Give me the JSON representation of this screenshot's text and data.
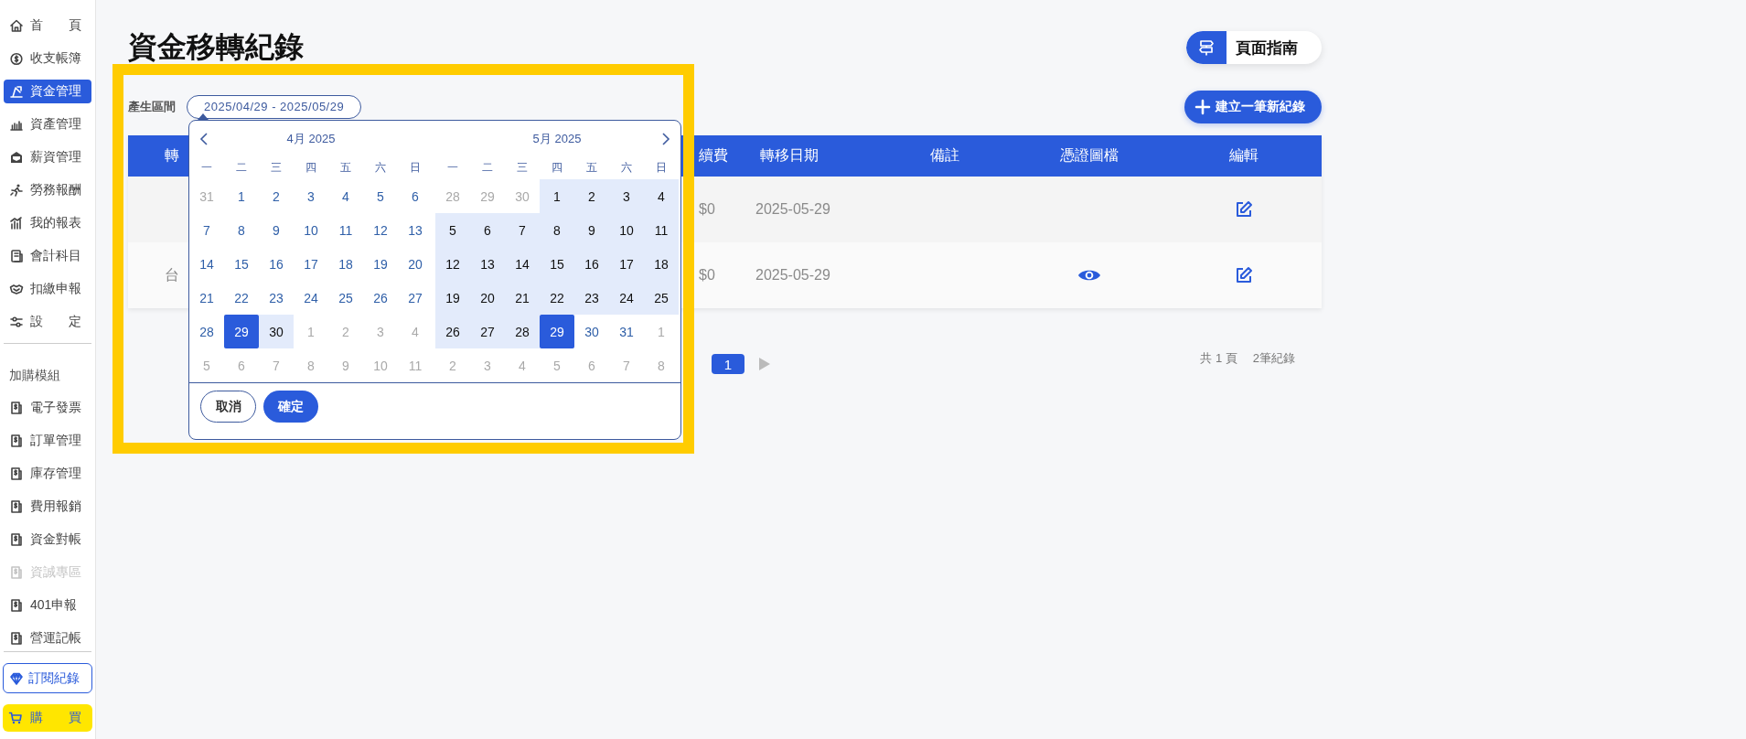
{
  "sidebar": {
    "items": [
      {
        "label": "首頁",
        "selected": false,
        "disabled": false
      },
      {
        "label": "收支帳簿",
        "selected": false,
        "disabled": false
      },
      {
        "label": "資金管理",
        "selected": true,
        "disabled": false
      },
      {
        "label": "資產管理",
        "selected": false,
        "disabled": false
      },
      {
        "label": "薪資管理",
        "selected": false,
        "disabled": false
      },
      {
        "label": "勞務報酬",
        "selected": false,
        "disabled": false
      },
      {
        "label": "我的報表",
        "selected": false,
        "disabled": false
      },
      {
        "label": "會計科目",
        "selected": false,
        "disabled": false
      },
      {
        "label": "扣繳申報",
        "selected": false,
        "disabled": false
      },
      {
        "label": "設定",
        "selected": false,
        "disabled": false
      }
    ],
    "section_title": "加購模組",
    "addon_items": [
      {
        "label": "電子發票",
        "selected": false,
        "disabled": false
      },
      {
        "label": "訂單管理",
        "selected": false,
        "disabled": false
      },
      {
        "label": "庫存管理",
        "selected": false,
        "disabled": false
      },
      {
        "label": "費用報銷",
        "selected": false,
        "disabled": false
      },
      {
        "label": "資金對帳",
        "selected": false,
        "disabled": false
      },
      {
        "label": "資誠專區",
        "selected": false,
        "disabled": true
      },
      {
        "label": "401申報",
        "selected": false,
        "disabled": false
      },
      {
        "label": "營運記帳",
        "selected": false,
        "disabled": false
      }
    ],
    "subscription_button": "訂閱紀錄",
    "buy_button": "購買"
  },
  "page": {
    "title": "資金移轉紀錄",
    "guide_button": "頁面指南",
    "new_record_button": "建立一筆新紀錄"
  },
  "date_filter": {
    "label": "產生區間",
    "value": "2025/04/29 - 2025/05/29"
  },
  "table": {
    "columns": [
      "轉",
      "續費",
      "轉移日期",
      "備註",
      "憑證圖檔",
      "編輯"
    ],
    "rows": [
      {
        "column_1": null,
        "fee": "$0",
        "date": "2025-05-29",
        "has_attachment": false
      },
      {
        "column_1": "台",
        "fee": "$0",
        "date": "2025-05-29",
        "has_attachment": true
      }
    ]
  },
  "pagination": {
    "pages": [
      {
        "label": "1",
        "selected": true
      }
    ],
    "total_pages": "共 1 頁",
    "total_records": "2筆紀錄"
  },
  "calendar": {
    "months": [
      {
        "title": "4月 2025",
        "weekdays": [
          "一",
          "二",
          "三",
          "四",
          "五",
          "六",
          "日"
        ],
        "weeks": [
          [
            {
              "label": "31",
              "kind": "outside",
              "selected": false
            },
            {
              "label": "1",
              "kind": "normal",
              "selected": false
            },
            {
              "label": "2",
              "kind": "normal",
              "selected": false
            },
            {
              "label": "3",
              "kind": "normal",
              "selected": false
            },
            {
              "label": "4",
              "kind": "normal",
              "selected": false
            },
            {
              "label": "5",
              "kind": "normal",
              "selected": false
            },
            {
              "label": "6",
              "kind": "normal",
              "selected": false
            }
          ],
          [
            {
              "label": "7",
              "kind": "normal",
              "selected": false
            },
            {
              "label": "8",
              "kind": "normal",
              "selected": false
            },
            {
              "label": "9",
              "kind": "normal",
              "selected": false
            },
            {
              "label": "10",
              "kind": "normal",
              "selected": false
            },
            {
              "label": "11",
              "kind": "normal",
              "selected": false
            },
            {
              "label": "12",
              "kind": "normal",
              "selected": false
            },
            {
              "label": "13",
              "kind": "normal",
              "selected": false
            }
          ],
          [
            {
              "label": "14",
              "kind": "normal",
              "selected": false
            },
            {
              "label": "15",
              "kind": "normal",
              "selected": false
            },
            {
              "label": "16",
              "kind": "normal",
              "selected": false
            },
            {
              "label": "17",
              "kind": "normal",
              "selected": false
            },
            {
              "label": "18",
              "kind": "normal",
              "selected": false
            },
            {
              "label": "19",
              "kind": "normal",
              "selected": false
            },
            {
              "label": "20",
              "kind": "normal",
              "selected": false
            }
          ],
          [
            {
              "label": "21",
              "kind": "normal",
              "selected": false
            },
            {
              "label": "22",
              "kind": "normal",
              "selected": false
            },
            {
              "label": "23",
              "kind": "normal",
              "selected": false
            },
            {
              "label": "24",
              "kind": "normal",
              "selected": false
            },
            {
              "label": "25",
              "kind": "normal",
              "selected": false
            },
            {
              "label": "26",
              "kind": "normal",
              "selected": false
            },
            {
              "label": "27",
              "kind": "normal",
              "selected": false
            }
          ],
          [
            {
              "label": "28",
              "kind": "normal",
              "selected": false
            },
            {
              "label": "29",
              "kind": "normal",
              "selected": true
            },
            {
              "label": "30",
              "kind": "range",
              "selected": false
            },
            {
              "label": "1",
              "kind": "outside",
              "selected": false
            },
            {
              "label": "2",
              "kind": "outside",
              "selected": false
            },
            {
              "label": "3",
              "kind": "outside",
              "selected": false
            },
            {
              "label": "4",
              "kind": "outside",
              "selected": false
            }
          ],
          [
            {
              "label": "5",
              "kind": "outside",
              "selected": false
            },
            {
              "label": "6",
              "kind": "outside",
              "selected": false
            },
            {
              "label": "7",
              "kind": "outside",
              "selected": false
            },
            {
              "label": "8",
              "kind": "outside",
              "selected": false
            },
            {
              "label": "9",
              "kind": "outside",
              "selected": false
            },
            {
              "label": "10",
              "kind": "outside",
              "selected": false
            },
            {
              "label": "11",
              "kind": "outside",
              "selected": false
            }
          ]
        ]
      },
      {
        "title": "5月 2025",
        "weekdays": [
          "一",
          "二",
          "三",
          "四",
          "五",
          "六",
          "日"
        ],
        "weeks": [
          [
            {
              "label": "28",
              "kind": "outside",
              "selected": false
            },
            {
              "label": "29",
              "kind": "outside",
              "selected": false
            },
            {
              "label": "30",
              "kind": "outside",
              "selected": false
            },
            {
              "label": "1",
              "kind": "range",
              "selected": false
            },
            {
              "label": "2",
              "kind": "range",
              "selected": false
            },
            {
              "label": "3",
              "kind": "range",
              "selected": false
            },
            {
              "label": "4",
              "kind": "range",
              "selected": false
            }
          ],
          [
            {
              "label": "5",
              "kind": "range",
              "selected": false
            },
            {
              "label": "6",
              "kind": "range",
              "selected": false
            },
            {
              "label": "7",
              "kind": "range",
              "selected": false
            },
            {
              "label": "8",
              "kind": "range",
              "selected": false
            },
            {
              "label": "9",
              "kind": "range",
              "selected": false
            },
            {
              "label": "10",
              "kind": "range",
              "selected": false
            },
            {
              "label": "11",
              "kind": "range",
              "selected": false
            }
          ],
          [
            {
              "label": "12",
              "kind": "range",
              "selected": false
            },
            {
              "label": "13",
              "kind": "range",
              "selected": false
            },
            {
              "label": "14",
              "kind": "range",
              "selected": false
            },
            {
              "label": "15",
              "kind": "range",
              "selected": false
            },
            {
              "label": "16",
              "kind": "range",
              "selected": false
            },
            {
              "label": "17",
              "kind": "range",
              "selected": false
            },
            {
              "label": "18",
              "kind": "range",
              "selected": false
            }
          ],
          [
            {
              "label": "19",
              "kind": "range",
              "selected": false
            },
            {
              "label": "20",
              "kind": "range",
              "selected": false
            },
            {
              "label": "21",
              "kind": "range",
              "selected": false
            },
            {
              "label": "22",
              "kind": "range",
              "selected": false
            },
            {
              "label": "23",
              "kind": "range",
              "selected": false
            },
            {
              "label": "24",
              "kind": "range",
              "selected": false
            },
            {
              "label": "25",
              "kind": "range",
              "selected": false
            }
          ],
          [
            {
              "label": "26",
              "kind": "range",
              "selected": false
            },
            {
              "label": "27",
              "kind": "range",
              "selected": false
            },
            {
              "label": "28",
              "kind": "range",
              "selected": false
            },
            {
              "label": "29",
              "kind": "normal",
              "selected": true
            },
            {
              "label": "30",
              "kind": "normal",
              "selected": false
            },
            {
              "label": "31",
              "kind": "normal",
              "selected": false
            },
            {
              "label": "1",
              "kind": "outside",
              "selected": false
            }
          ],
          [
            {
              "label": "2",
              "kind": "outside",
              "selected": false
            },
            {
              "label": "3",
              "kind": "outside",
              "selected": false
            },
            {
              "label": "4",
              "kind": "outside",
              "selected": false
            },
            {
              "label": "5",
              "kind": "outside",
              "selected": false
            },
            {
              "label": "6",
              "kind": "outside",
              "selected": false
            },
            {
              "label": "7",
              "kind": "outside",
              "selected": false
            },
            {
              "label": "8",
              "kind": "outside",
              "selected": false
            }
          ]
        ]
      }
    ],
    "cancel_button": "取消",
    "confirm_button": "確定"
  }
}
